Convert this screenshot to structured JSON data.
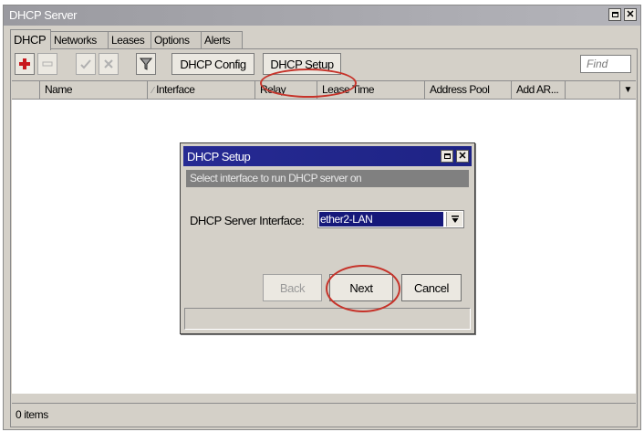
{
  "window": {
    "title": "DHCP Server"
  },
  "tabs": [
    {
      "label": "DHCP",
      "active": true
    },
    {
      "label": "Networks"
    },
    {
      "label": "Leases"
    },
    {
      "label": "Options"
    },
    {
      "label": "Alerts"
    }
  ],
  "toolbar": {
    "add_icon": "plus-icon",
    "remove_icon": "minus-icon",
    "enable_icon": "check-icon",
    "disable_icon": "cross-icon",
    "filter_icon": "filter-icon",
    "dhcp_config_label": "DHCP Config",
    "dhcp_setup_label": "DHCP Setup",
    "find_placeholder": "Find"
  },
  "table": {
    "columns": [
      "Name",
      "Interface",
      "Relay",
      "Lease Time",
      "Address Pool",
      "Add AR..."
    ],
    "rows": []
  },
  "status": {
    "item_count": "0 items"
  },
  "dialog": {
    "title": "DHCP Setup",
    "instruction": "Select interface to run DHCP server on",
    "field_label": "DHCP Server Interface:",
    "field_value": "ether2-LAN",
    "back_label": "Back",
    "next_label": "Next",
    "cancel_label": "Cancel"
  },
  "colors": {
    "highlight_ring": "#c6332a",
    "dialog_titlebar": "#262a93",
    "add_icon": "#c8181e"
  }
}
